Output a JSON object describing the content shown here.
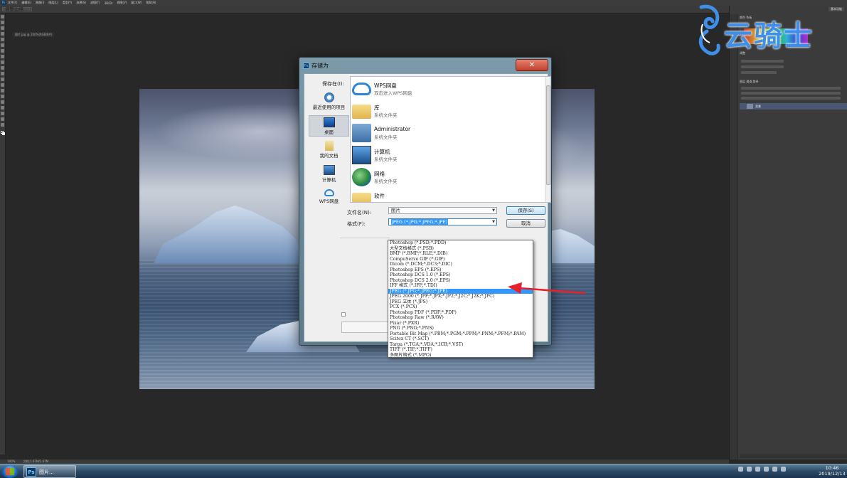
{
  "app": {
    "menu": [
      "文件(F)",
      "编辑(E)",
      "图像(I)",
      "图层(L)",
      "类型(Y)",
      "选择(S)",
      "滤镜(T)",
      "3D(D)",
      "视图(V)",
      "窗口(W)",
      "帮助(H)"
    ],
    "doc_tab": "图片.jpg @ 100%(RGB/8#)",
    "workspace_button": "基本功能",
    "status_zoom": "100%",
    "status_doc": "文档:1.67M/1.67M"
  },
  "watermark": "云骑士",
  "dialog": {
    "title": "存储为",
    "save_in_label": "保存在(I):",
    "save_in_value": "桌面",
    "places": [
      {
        "label": "最近使用的项目",
        "icon": "recent-icon"
      },
      {
        "label": "桌面",
        "icon": "desktop-icon"
      },
      {
        "label": "我的文档",
        "icon": "documents-icon"
      },
      {
        "label": "计算机",
        "icon": "computer-icon"
      },
      {
        "label": "WPS网盘",
        "icon": "cloud-icon"
      }
    ],
    "files": [
      {
        "name": "WPS网盘",
        "desc": "双击进入WPS网盘",
        "icon": "cloud-icon"
      },
      {
        "name": "库",
        "desc": "系统文件夹",
        "icon": "folder-icon"
      },
      {
        "name": "Administrator",
        "desc": "系统文件夹",
        "icon": "user-folder-icon"
      },
      {
        "name": "计算机",
        "desc": "系统文件夹",
        "icon": "computer-icon"
      },
      {
        "name": "网络",
        "desc": "系统文件夹",
        "icon": "network-icon"
      },
      {
        "name": "软件",
        "desc": "",
        "icon": "folder-icon"
      }
    ],
    "filename_label": "文件名(N):",
    "filename_value": "图片",
    "format_label": "格式(F):",
    "format_value": "JPEG (*.JPG;*.JPEG;*.JPE)",
    "save_button": "保存(S)",
    "cancel_button": "取消",
    "format_options": [
      "Photoshop (*.PSD;*.PDD)",
      "大型文档格式 (*.PSB)",
      "BMP (*.BMP;*.RLE;*.DIB)",
      "CompuServe GIF (*.GIF)",
      "Dicom (*.DCM;*.DC3;*.DIC)",
      "Photoshop EPS (*.EPS)",
      "Photoshop DCS 1.0 (*.EPS)",
      "Photoshop DCS 2.0 (*.EPS)",
      "IFF 格式 (*.IFF;*.TDI)",
      "JPEG (*.JPG;*.JPEG;*.JPE)",
      "JPEG 2000 (*.JPF;*.JPX;*.JP2;*.J2C;*.J2K;*.JPC)",
      "JPEG 立体 (*.JPS)",
      "PCX (*.PCX)",
      "Photoshop PDF (*.PDF;*.PDP)",
      "Photoshop Raw (*.RAW)",
      "Pixar (*.PXR)",
      "PNG (*.PNG;*.PNS)",
      "Portable Bit Map (*.PBM;*.PGM;*.PPM;*.PNM;*.PFM;*.PAM)",
      "Scitex CT (*.SCT)",
      "Targa (*.TGA;*.VDA;*.ICB;*.VST)",
      "TIFF (*.TIF;*.TIFF)",
      "多图片格式 (*.MPO)"
    ],
    "highlighted_option_index": 9
  },
  "taskbar": {
    "ps_label": "图片...",
    "time": "10:46",
    "date": "2019/12/13"
  },
  "colors": {
    "highlight": "#3399ff",
    "arrow": "#e8202a",
    "watermark": "#3f8ee8"
  }
}
